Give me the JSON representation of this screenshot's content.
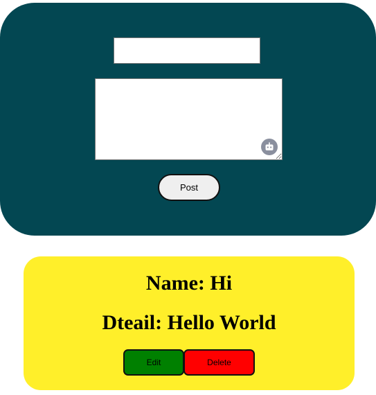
{
  "colors": {
    "form_panel_bg": "#034752",
    "card_bg": "#ffef2a",
    "edit_button_bg": "#008000",
    "delete_button_bg": "#ff0000",
    "post_button_bg": "#efefef"
  },
  "form": {
    "name_value": "",
    "detail_value": "",
    "assistant_icon": "robot-icon",
    "post_label": "Post"
  },
  "card": {
    "name_text": "Name: Hi",
    "detail_text": "Dteail: Hello World",
    "edit_label": "Edit",
    "delete_label": "Delete"
  }
}
